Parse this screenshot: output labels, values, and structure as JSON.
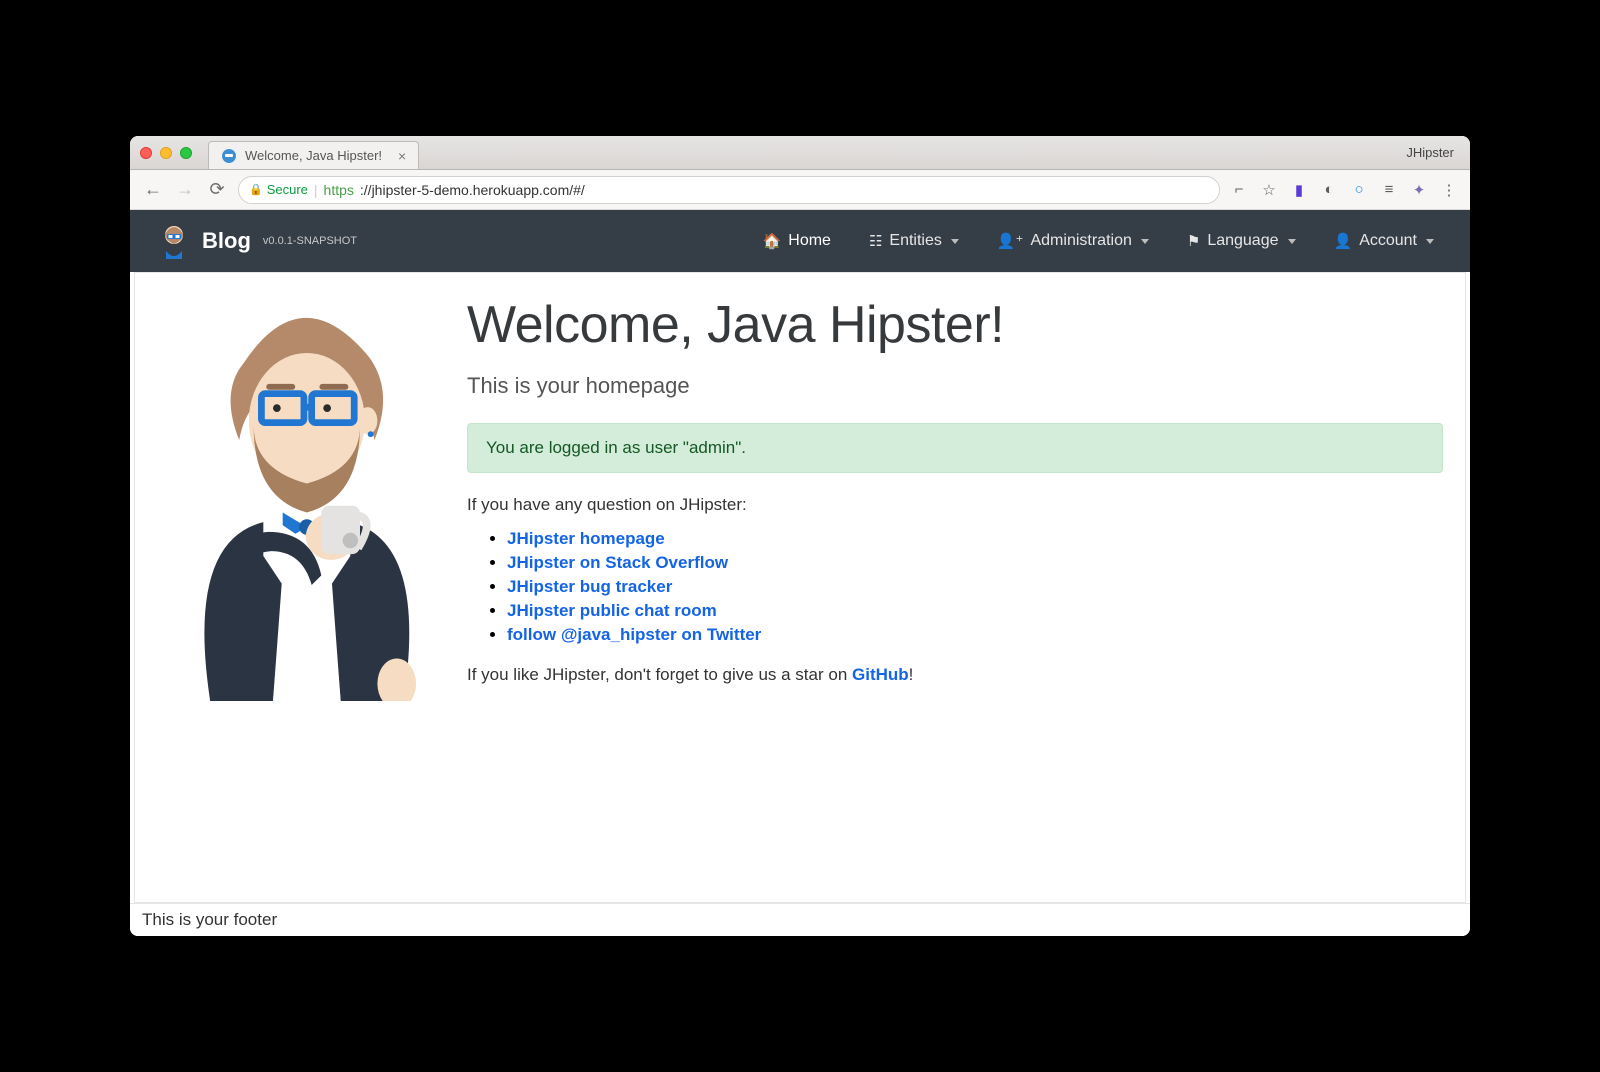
{
  "browser": {
    "tab_title": "Welcome, Java Hipster!",
    "window_label": "JHipster",
    "secure_label": "Secure",
    "url_protocol": "https",
    "url_rest": "://jhipster-5-demo.herokuapp.com/#/"
  },
  "navbar": {
    "brand": "Blog",
    "version": "v0.0.1-SNAPSHOT",
    "items": {
      "home": "Home",
      "entities": "Entities",
      "administration": "Administration",
      "language": "Language",
      "account": "Account"
    }
  },
  "page": {
    "title": "Welcome, Java Hipster!",
    "subtitle": "This is your homepage",
    "alert": "You are logged in as user \"admin\".",
    "question": "If you have any question on JHipster:",
    "links": [
      "JHipster homepage",
      "JHipster on Stack Overflow",
      "JHipster bug tracker",
      "JHipster public chat room",
      "follow @java_hipster on Twitter"
    ],
    "star_prefix": "If you like JHipster, don't forget to give us a star on ",
    "star_link": "GitHub",
    "star_suffix": "!"
  },
  "footer": "This is your footer"
}
